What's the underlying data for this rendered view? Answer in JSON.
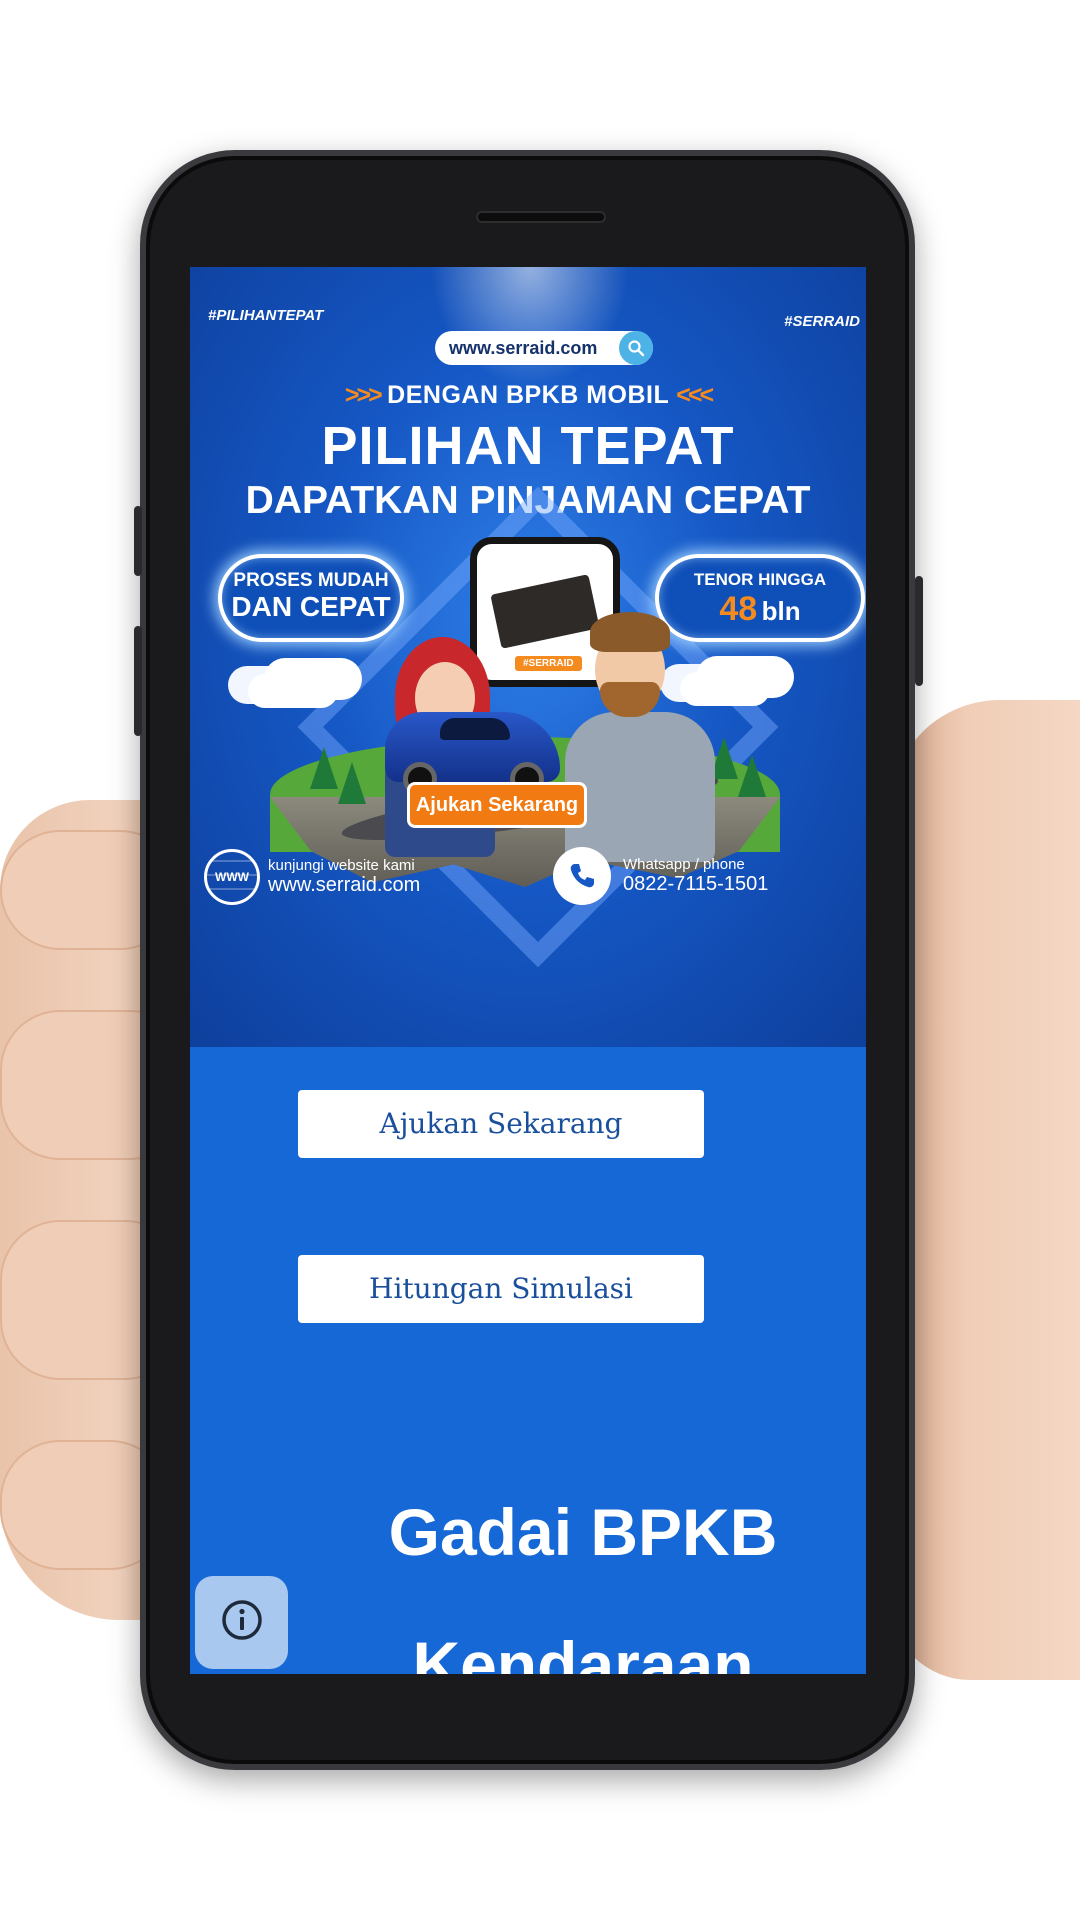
{
  "banner": {
    "hashtag_left": "#PILIHANTEPAT",
    "hashtag_right": "#SERRAID",
    "url": "www.serraid.com",
    "subhead": "DENGAN BPKB MOBIL",
    "chevrons_left": ">>>",
    "chevrons_right": "<<<",
    "headline": "PILIHAN TEPAT",
    "headline2": "DAPATKAN PINJAMAN CEPAT",
    "pill_left_line1": "PROSES MUDAH",
    "pill_left_line2": "DAN CEPAT",
    "pill_right_line1": "TENOR HINGGA",
    "pill_right_number": "48",
    "pill_right_unit": "bln",
    "mini_tag": "#SERRAID",
    "cta": "Ajukan Sekarang",
    "globe_label": "WWW",
    "footer_left_small": "kunjungi website kami",
    "footer_left_big": "www.serraid.com",
    "footer_right_small": "Whatsapp / phone",
    "footer_right_big": "0822-7115-1501"
  },
  "buttons": {
    "ajukan": "Ajukan Sekarang",
    "hitungan": "Hitungan Simulasi"
  },
  "title": {
    "line1": "Gadai BPKB",
    "line2": "Kendaraan"
  },
  "colors": {
    "accent_orange": "#f27a12",
    "screen_blue": "#1668d6"
  },
  "icons": {
    "url_search": "search-icon",
    "footer_left": "globe-icon",
    "footer_right": "phone-icon",
    "fab": "info-icon"
  }
}
